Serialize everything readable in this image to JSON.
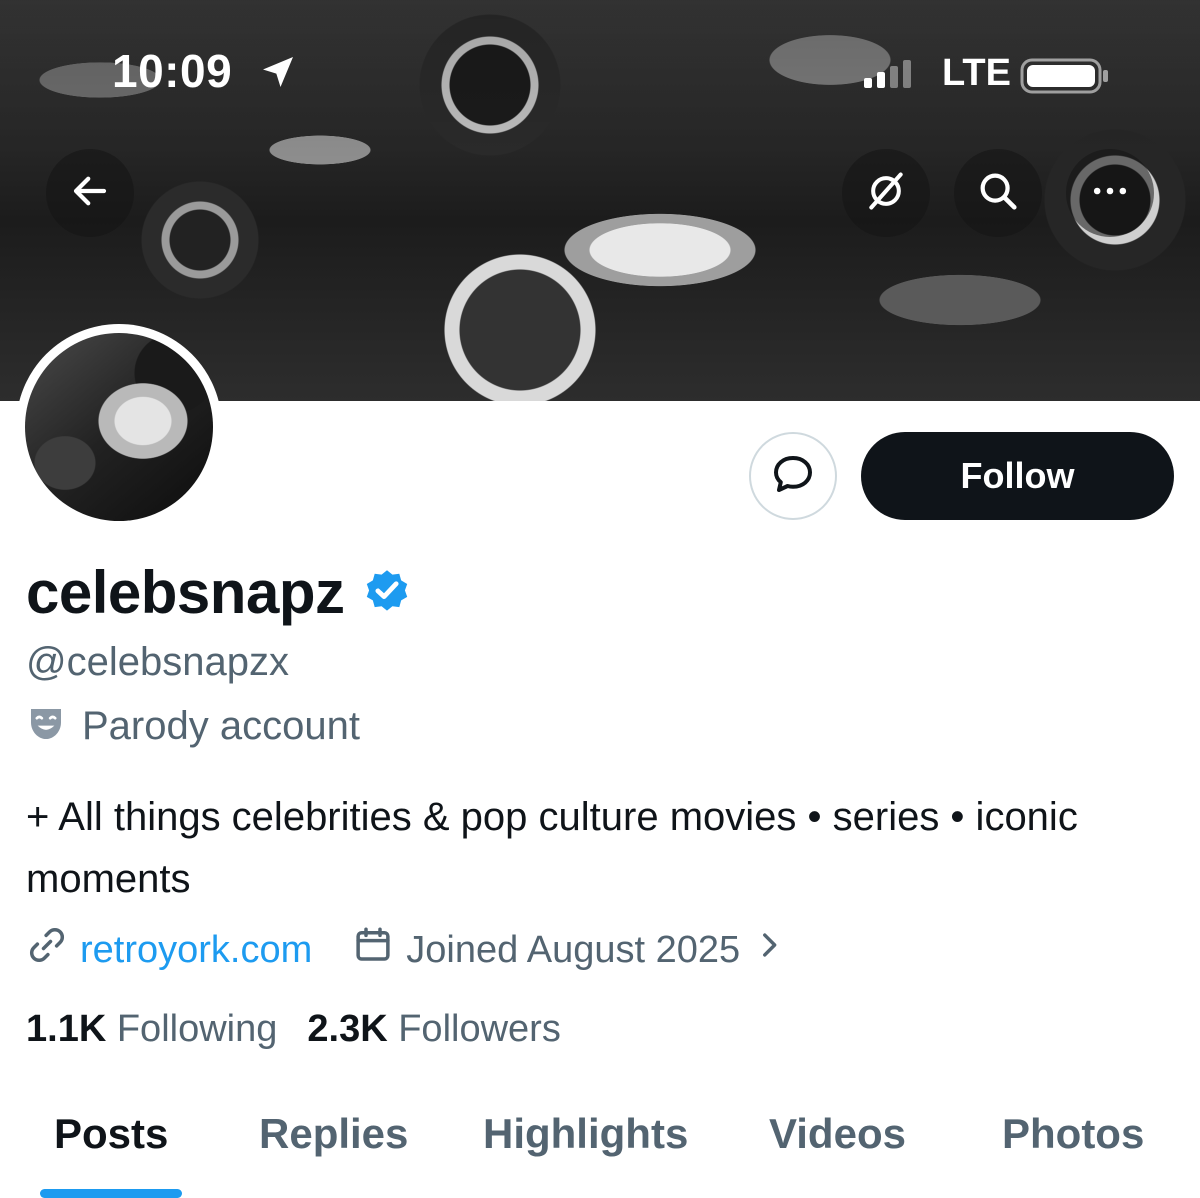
{
  "status_bar": {
    "time": "10:09",
    "network": "LTE",
    "location_icon": "location-arrow-icon",
    "signal_icon": "signal-bars-icon",
    "battery_icon": "battery-icon"
  },
  "header": {
    "back_icon": "arrow-left-icon",
    "grok_icon": "grok-icon",
    "search_icon": "search-icon",
    "more_icon": "more-horizontal-icon"
  },
  "actions": {
    "message_icon": "message-bubble-icon",
    "follow_label": "Follow"
  },
  "profile": {
    "display_name": "celebsnapz",
    "verified_icon": "verified-badge-icon",
    "handle": "@celebsnapzx",
    "parody_icon": "theater-masks-icon",
    "parody_label": "Parody account",
    "bio": "+ All things celebrities & pop culture movies • series • iconic moments",
    "website": "retroyork.com",
    "link_icon": "link-icon",
    "calendar_icon": "calendar-icon",
    "joined": "Joined August 2025",
    "chevron_icon": "chevron-right-icon",
    "following_count": "1.1K",
    "following_label": "Following",
    "followers_count": "2.3K",
    "followers_label": "Followers"
  },
  "tabs": [
    {
      "label": "Posts",
      "active": true
    },
    {
      "label": "Replies",
      "active": false
    },
    {
      "label": "Highlights",
      "active": false
    },
    {
      "label": "Videos",
      "active": false
    },
    {
      "label": "Photos",
      "active": false
    }
  ],
  "colors": {
    "accent": "#1d9bf0",
    "text_primary": "#0f1419",
    "text_secondary": "#536471",
    "follow_button_bg": "#0f1419"
  }
}
